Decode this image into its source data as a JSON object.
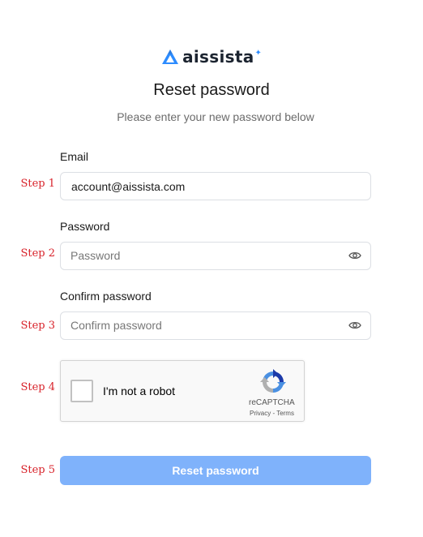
{
  "brand": {
    "name": "aissista",
    "accent": "#2d8cff"
  },
  "page": {
    "title": "Reset password",
    "subtitle": "Please enter your new password below"
  },
  "steps": [
    "Step 1",
    "Step 2",
    "Step 3",
    "Step 4",
    "Step 5"
  ],
  "form": {
    "email": {
      "label": "Email",
      "value": "account@aissista.com"
    },
    "password": {
      "label": "Password",
      "placeholder": "Password",
      "icon": "eye-icon"
    },
    "confirm": {
      "label": "Confirm password",
      "placeholder": "Confirm password",
      "icon": "eye-icon"
    },
    "captcha": {
      "label": "I'm not a robot",
      "brand": "reCAPTCHA",
      "links": "Privacy - Terms"
    },
    "submit": {
      "label": "Reset password",
      "color": "#7fb2fb"
    }
  },
  "colors": {
    "step_annotation": "#d8222a",
    "field_border": "#dcdfe4"
  }
}
